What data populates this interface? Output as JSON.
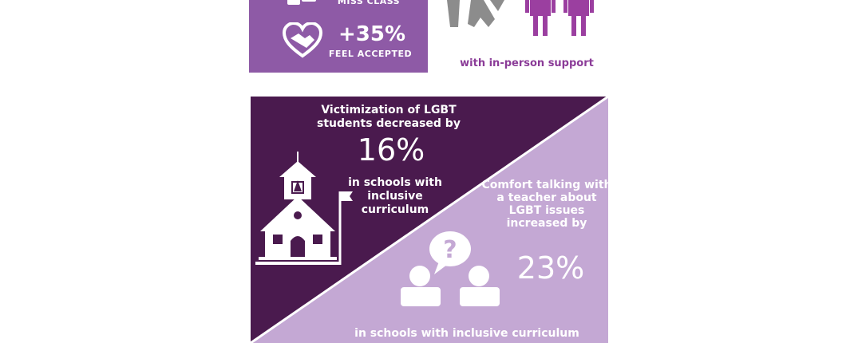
{
  "top_panel": {
    "miss_class": "MISS CLASS",
    "accepted_value": "+35%",
    "accepted_label": "FEEL ACCEPTED"
  },
  "support": {
    "caption": "with in-person support"
  },
  "victimization": {
    "title": "Victimization of LGBT students decreased by",
    "value": "16%",
    "tail": "in schools with inclusive curriculum"
  },
  "comfort": {
    "title": "Comfort talking with a teacher about LGBT issues increased by",
    "value": "23%",
    "tail": "in schools with inclusive curriculum"
  },
  "colors": {
    "panel_purple": "#8e5aa6",
    "dark_purple": "#4a1a4e",
    "light_purple": "#c4a8d4",
    "accent_purple": "#8b3c98",
    "gray": "#8c8c8c"
  }
}
